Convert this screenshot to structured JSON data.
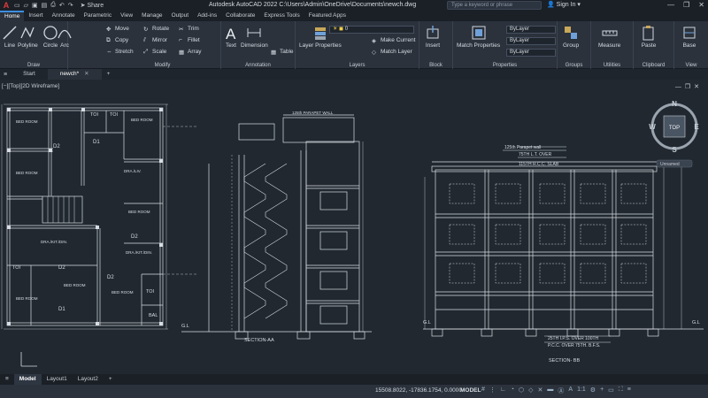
{
  "app": {
    "title": "Autodesk AutoCAD 2022    C:\\Users\\Admin\\OneDrive\\Documents\\newch.dwg",
    "share_label": "Share",
    "search_placeholder": "Type a keyword or phrase",
    "signin_label": "Sign In"
  },
  "ribbon_tabs": [
    "Home",
    "Insert",
    "Annotate",
    "Parametric",
    "View",
    "Manage",
    "Output",
    "Add-ins",
    "Collaborate",
    "Express Tools",
    "Featured Apps"
  ],
  "panels": {
    "draw": {
      "label": "Draw",
      "tools": [
        "Line",
        "Polyline",
        "Circle",
        "Arc"
      ]
    },
    "modify": {
      "label": "Modify",
      "tools": [
        "Move",
        "Rotate",
        "Trim",
        "Copy",
        "Mirror",
        "Fillet",
        "Stretch",
        "Scale",
        "Array"
      ]
    },
    "annotation": {
      "label": "Annotation",
      "tools": [
        "Text",
        "Dimension",
        "Table"
      ]
    },
    "layers": {
      "label": "Layers",
      "tools": [
        "Layer Properties",
        "Make Current",
        "Match Layer"
      ],
      "current_layer": "0"
    },
    "block": {
      "label": "Block",
      "tools": [
        "Insert"
      ]
    },
    "properties": {
      "label": "Properties",
      "tools": [
        "Match Properties"
      ],
      "color": "ByLayer",
      "linetype": "ByLayer",
      "lineweight": "ByLayer"
    },
    "groups": {
      "label": "Groups",
      "tools": [
        "Group"
      ]
    },
    "utilities": {
      "label": "Utilities",
      "tools": [
        "Measure"
      ]
    },
    "clipboard": {
      "label": "Clipboard",
      "tools": [
        "Paste"
      ]
    },
    "view": {
      "label": "View",
      "tools": [
        "Base"
      ]
    }
  },
  "file_tabs": [
    "Start",
    "newch*"
  ],
  "viewport": {
    "label": "[−][Top][2D Wireframe]",
    "viewcube": {
      "top": "TOP",
      "north": "N",
      "south": "S",
      "east": "E",
      "west": "W",
      "ucs": "Unnamed"
    }
  },
  "drawing": {
    "plan_rooms": [
      "BED ROOM",
      "TOI",
      "D1",
      "D2",
      "DRA./LIV.",
      "DRA./KIT./DIN.",
      "BAL"
    ],
    "section_aa": {
      "title": "SECTION-AA",
      "note_top": "125th PARAPET WALL",
      "gl": "G.L"
    },
    "section_bb": {
      "title": "SECTION- BB",
      "note_top": "125th Parapet wall",
      "slab_note_1": "75TH L.T. OVER",
      "slab_note_2": "115TH R.C.C. SLAB",
      "footing_note_1": "25TH I.P.S. OVER 100TH",
      "footing_note_2": "P.C.C.     OVER 75TH. B.F.S.",
      "gl": "G.L"
    }
  },
  "layout_tabs": [
    "Model",
    "Layout1",
    "Layout2"
  ],
  "status": {
    "coords": "15508.8022, -17836.1754, 0.0000",
    "mode": "MODEL",
    "scale": "1:1"
  }
}
